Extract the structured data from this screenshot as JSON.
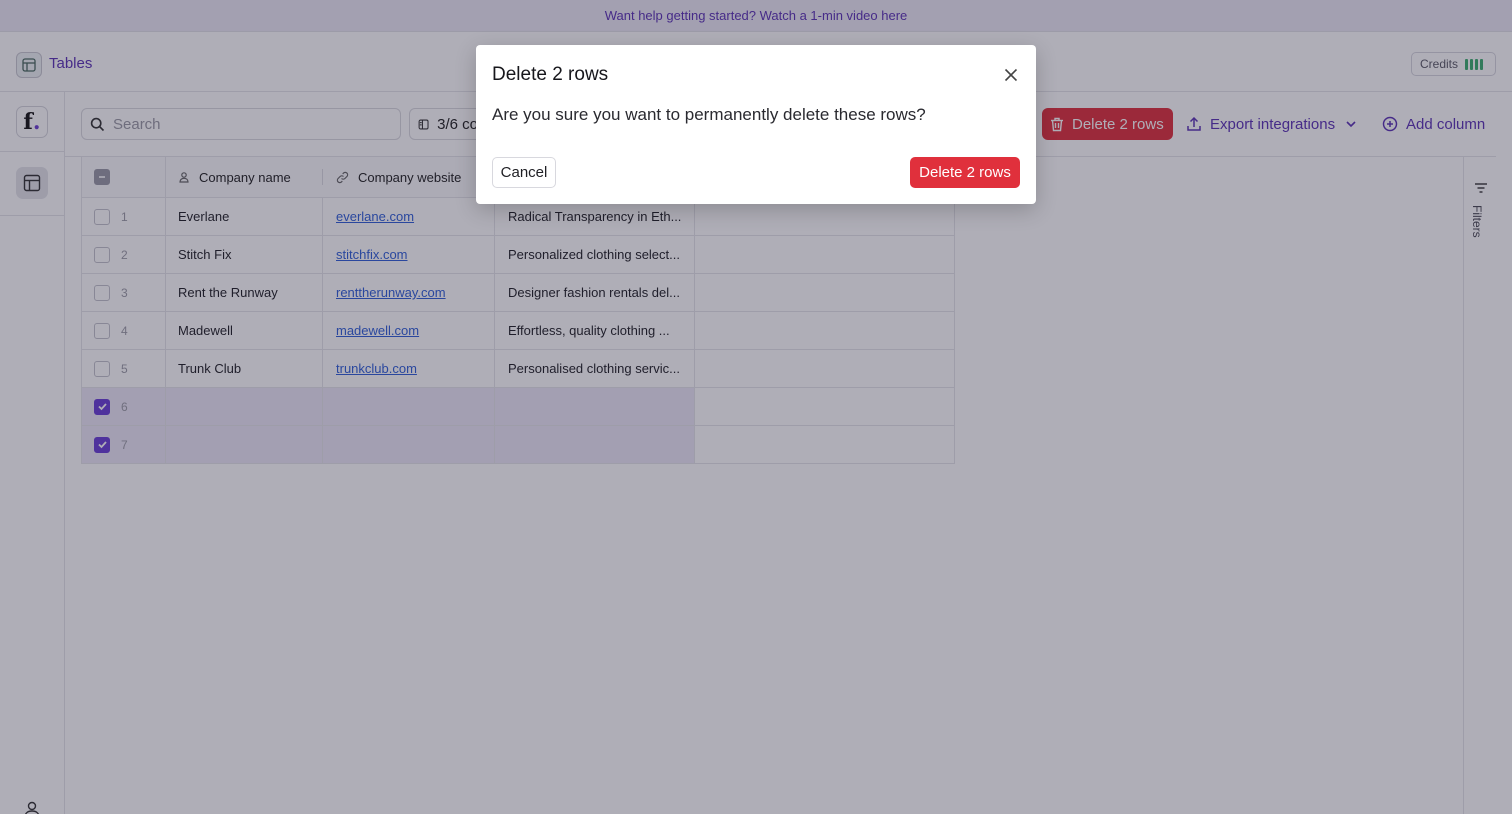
{
  "banner": {
    "text": "Want help getting started? Watch a 1-min video here"
  },
  "header": {
    "section_label": "Tables",
    "credits_label": "Credits"
  },
  "sidebar": {
    "logo_letter": "f",
    "logo_dot": "."
  },
  "toolbar": {
    "search_placeholder": "Search",
    "columns_label": "3/6 columns",
    "delete_label": "Delete 2 rows",
    "export_label": "Export integrations",
    "add_column_label": "Add column"
  },
  "table": {
    "columns": [
      {
        "label": "Company name",
        "icon": "person-icon"
      },
      {
        "label": "Company website",
        "icon": "link-icon"
      }
    ],
    "rows": [
      {
        "num": "1",
        "name": "Everlane",
        "website": "everlane.com",
        "description": "Radical Transparency in Eth...",
        "selected": false
      },
      {
        "num": "2",
        "name": "Stitch Fix",
        "website": "stitchfix.com",
        "description": "Personalized clothing select...",
        "selected": false
      },
      {
        "num": "3",
        "name": "Rent the Runway",
        "website": "renttherunway.com",
        "description": "Designer fashion rentals del...",
        "selected": false
      },
      {
        "num": "4",
        "name": "Madewell",
        "website": "madewell.com",
        "description": "Effortless, quality clothing ...",
        "selected": false
      },
      {
        "num": "5",
        "name": "Trunk Club",
        "website": "trunkclub.com",
        "description": "Personalised clothing servic...",
        "selected": false
      },
      {
        "num": "6",
        "name": "",
        "website": "",
        "description": "",
        "selected": true
      },
      {
        "num": "7",
        "name": "",
        "website": "",
        "description": "",
        "selected": true
      }
    ]
  },
  "filters": {
    "label": "Filters"
  },
  "modal": {
    "title": "Delete 2 rows",
    "body": "Are you sure you want to permanently delete these rows?",
    "cancel_label": "Cancel",
    "confirm_label": "Delete 2 rows"
  },
  "colors": {
    "accent": "#5b32b6",
    "danger": "#e0303c",
    "checkbox": "#6a3ed6",
    "credits_bar": "#3cae6f"
  }
}
